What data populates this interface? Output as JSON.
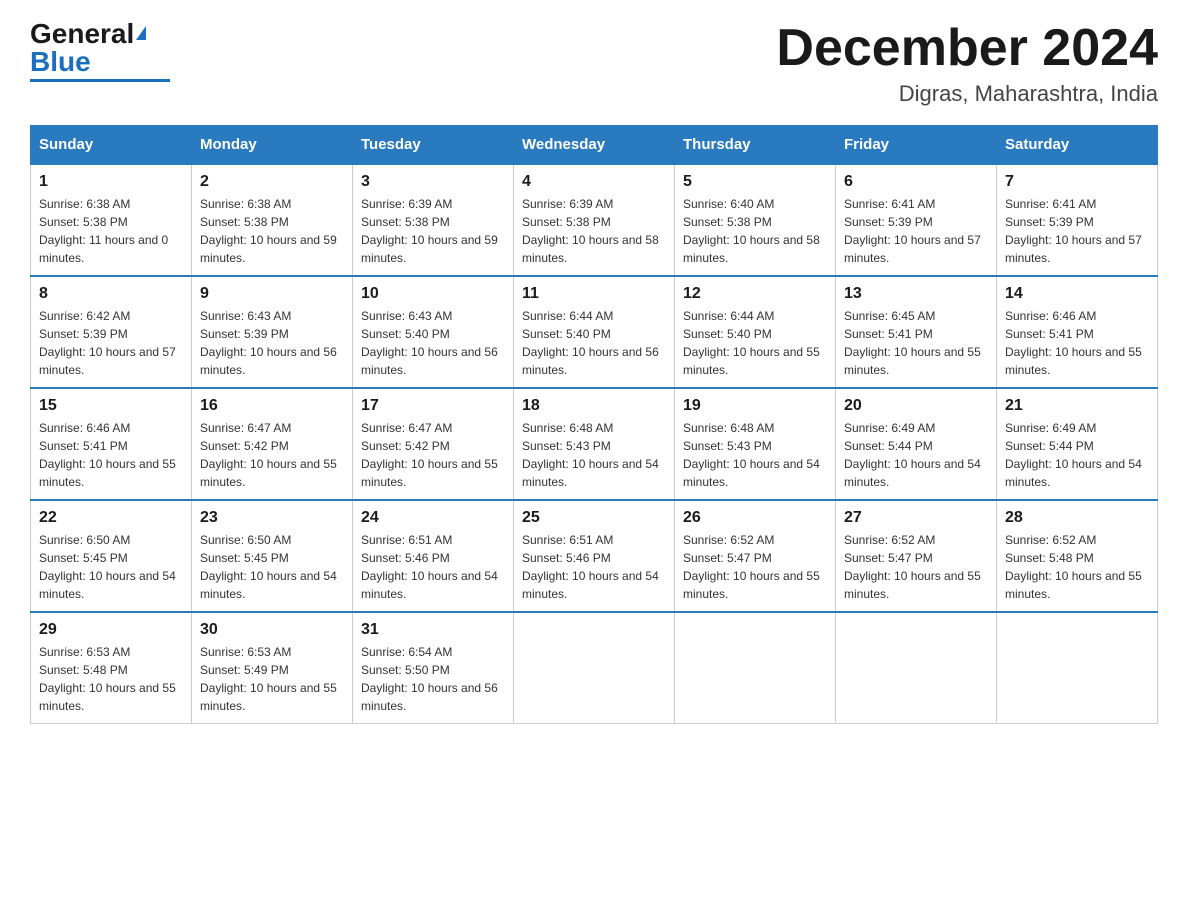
{
  "header": {
    "logo_general": "General",
    "logo_blue": "Blue",
    "month_year": "December 2024",
    "location": "Digras, Maharashtra, India"
  },
  "days_of_week": [
    "Sunday",
    "Monday",
    "Tuesday",
    "Wednesday",
    "Thursday",
    "Friday",
    "Saturday"
  ],
  "weeks": [
    [
      {
        "day": "1",
        "sunrise": "6:38 AM",
        "sunset": "5:38 PM",
        "daylight": "11 hours and 0 minutes."
      },
      {
        "day": "2",
        "sunrise": "6:38 AM",
        "sunset": "5:38 PM",
        "daylight": "10 hours and 59 minutes."
      },
      {
        "day": "3",
        "sunrise": "6:39 AM",
        "sunset": "5:38 PM",
        "daylight": "10 hours and 59 minutes."
      },
      {
        "day": "4",
        "sunrise": "6:39 AM",
        "sunset": "5:38 PM",
        "daylight": "10 hours and 58 minutes."
      },
      {
        "day": "5",
        "sunrise": "6:40 AM",
        "sunset": "5:38 PM",
        "daylight": "10 hours and 58 minutes."
      },
      {
        "day": "6",
        "sunrise": "6:41 AM",
        "sunset": "5:39 PM",
        "daylight": "10 hours and 57 minutes."
      },
      {
        "day": "7",
        "sunrise": "6:41 AM",
        "sunset": "5:39 PM",
        "daylight": "10 hours and 57 minutes."
      }
    ],
    [
      {
        "day": "8",
        "sunrise": "6:42 AM",
        "sunset": "5:39 PM",
        "daylight": "10 hours and 57 minutes."
      },
      {
        "day": "9",
        "sunrise": "6:43 AM",
        "sunset": "5:39 PM",
        "daylight": "10 hours and 56 minutes."
      },
      {
        "day": "10",
        "sunrise": "6:43 AM",
        "sunset": "5:40 PM",
        "daylight": "10 hours and 56 minutes."
      },
      {
        "day": "11",
        "sunrise": "6:44 AM",
        "sunset": "5:40 PM",
        "daylight": "10 hours and 56 minutes."
      },
      {
        "day": "12",
        "sunrise": "6:44 AM",
        "sunset": "5:40 PM",
        "daylight": "10 hours and 55 minutes."
      },
      {
        "day": "13",
        "sunrise": "6:45 AM",
        "sunset": "5:41 PM",
        "daylight": "10 hours and 55 minutes."
      },
      {
        "day": "14",
        "sunrise": "6:46 AM",
        "sunset": "5:41 PM",
        "daylight": "10 hours and 55 minutes."
      }
    ],
    [
      {
        "day": "15",
        "sunrise": "6:46 AM",
        "sunset": "5:41 PM",
        "daylight": "10 hours and 55 minutes."
      },
      {
        "day": "16",
        "sunrise": "6:47 AM",
        "sunset": "5:42 PM",
        "daylight": "10 hours and 55 minutes."
      },
      {
        "day": "17",
        "sunrise": "6:47 AM",
        "sunset": "5:42 PM",
        "daylight": "10 hours and 55 minutes."
      },
      {
        "day": "18",
        "sunrise": "6:48 AM",
        "sunset": "5:43 PM",
        "daylight": "10 hours and 54 minutes."
      },
      {
        "day": "19",
        "sunrise": "6:48 AM",
        "sunset": "5:43 PM",
        "daylight": "10 hours and 54 minutes."
      },
      {
        "day": "20",
        "sunrise": "6:49 AM",
        "sunset": "5:44 PM",
        "daylight": "10 hours and 54 minutes."
      },
      {
        "day": "21",
        "sunrise": "6:49 AM",
        "sunset": "5:44 PM",
        "daylight": "10 hours and 54 minutes."
      }
    ],
    [
      {
        "day": "22",
        "sunrise": "6:50 AM",
        "sunset": "5:45 PM",
        "daylight": "10 hours and 54 minutes."
      },
      {
        "day": "23",
        "sunrise": "6:50 AM",
        "sunset": "5:45 PM",
        "daylight": "10 hours and 54 minutes."
      },
      {
        "day": "24",
        "sunrise": "6:51 AM",
        "sunset": "5:46 PM",
        "daylight": "10 hours and 54 minutes."
      },
      {
        "day": "25",
        "sunrise": "6:51 AM",
        "sunset": "5:46 PM",
        "daylight": "10 hours and 54 minutes."
      },
      {
        "day": "26",
        "sunrise": "6:52 AM",
        "sunset": "5:47 PM",
        "daylight": "10 hours and 55 minutes."
      },
      {
        "day": "27",
        "sunrise": "6:52 AM",
        "sunset": "5:47 PM",
        "daylight": "10 hours and 55 minutes."
      },
      {
        "day": "28",
        "sunrise": "6:52 AM",
        "sunset": "5:48 PM",
        "daylight": "10 hours and 55 minutes."
      }
    ],
    [
      {
        "day": "29",
        "sunrise": "6:53 AM",
        "sunset": "5:48 PM",
        "daylight": "10 hours and 55 minutes."
      },
      {
        "day": "30",
        "sunrise": "6:53 AM",
        "sunset": "5:49 PM",
        "daylight": "10 hours and 55 minutes."
      },
      {
        "day": "31",
        "sunrise": "6:54 AM",
        "sunset": "5:50 PM",
        "daylight": "10 hours and 56 minutes."
      },
      null,
      null,
      null,
      null
    ]
  ]
}
